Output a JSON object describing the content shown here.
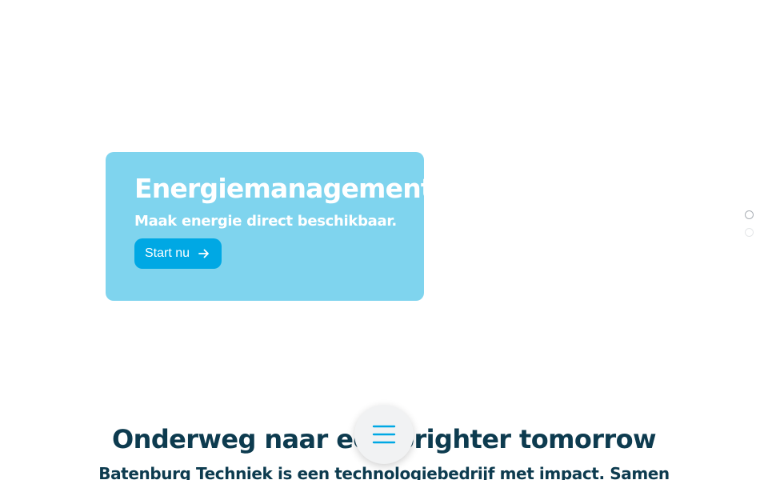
{
  "hero": {
    "title": "Energiemanagement.",
    "subtitle": "Maak energie direct beschikbaar.",
    "cta_label": "Start nu",
    "cta_icon": "arrow-right-icon",
    "card_color": "#7fd4ee",
    "button_color": "#00a8e4"
  },
  "slider": {
    "slide_count": 2,
    "active_index": 0
  },
  "section": {
    "heading": "Onderweg naar een brighter tomorrow",
    "lead": "Batenburg Techniek is een technologiebedrijf met impact. Samen"
  },
  "menu_button": {
    "icon": "hamburger-menu-icon",
    "icon_color": "#00a8e4"
  },
  "colors": {
    "heading_text": "#0d3b4f",
    "hero_text": "#ffffff"
  }
}
